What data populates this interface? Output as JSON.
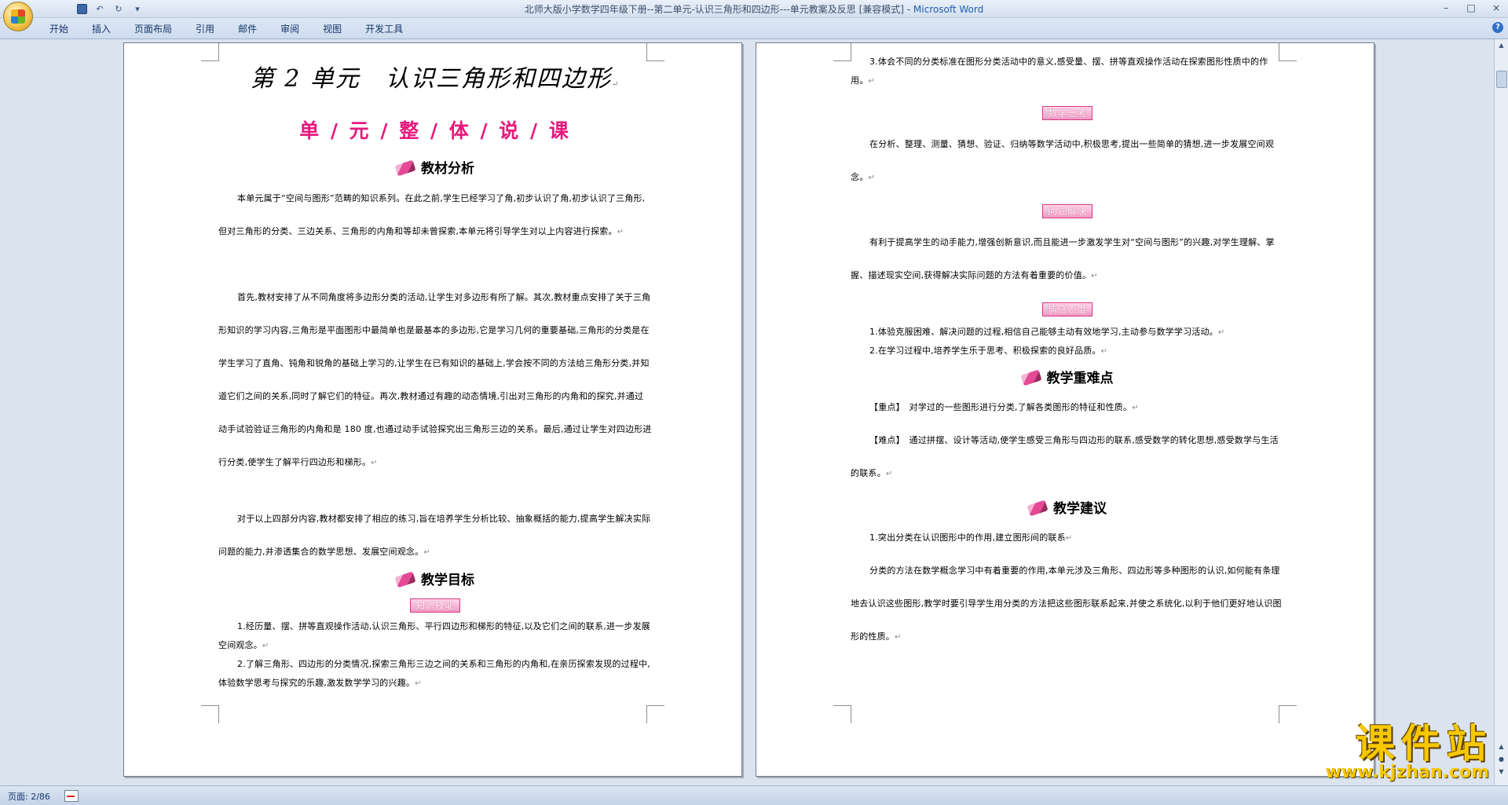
{
  "window": {
    "title": "北师大版小学数学四年级下册--第二单元-认识三角形和四边形---单元教案及反思 [兼容模式]",
    "title_separator": " - ",
    "app_name": "Microsoft Word",
    "controls": {
      "minimize": "–",
      "maximize": "□",
      "close": "×"
    }
  },
  "qat": {
    "save_icon": "save-icon",
    "undo": "↶",
    "redo": "↻",
    "customize": "▾"
  },
  "ribbon": {
    "tabs": [
      "开始",
      "插入",
      "页面布局",
      "引用",
      "邮件",
      "审阅",
      "视图",
      "开发工具"
    ],
    "help": "?"
  },
  "page1": {
    "title": "第 2 单元　认识三角形和四边形",
    "subtitle": "单 / 元 / 整 / 体 / 说 / 课",
    "sections": {
      "analysis": "教材分析",
      "goals": "教学目标",
      "knowledge_tag": "知识技能"
    },
    "para1": "本单元属于“空间与图形”范畴的知识系列。在此之前,学生已经学习了角,初步认识了角,初步认识了三角形,但对三角形的分类、三边关系、三角形的内角和等却未曾探索,本单元将引导学生对以上内容进行探索。",
    "para2": "首先,教材安排了从不同角度将多边形分类的活动,让学生对多边形有所了解。其次,教材重点安排了关于三角形知识的学习内容,三角形是平面图形中最简单也是最基本的多边形,它是学习几何的重要基础,三角形的分类是在学生学习了直角、钝角和锐角的基础上学习的,让学生在已有知识的基础上,学会按不同的方法给三角形分类,并知道它们之间的关系,同时了解它们的特征。再次,教材通过有趣的动态情境,引出对三角形的内角和的探究,并通过动手试验验证三角形的内角和是 180 度,也通过动手试验探究出三角形三边的关系。最后,通过让学生对四边形进行分类,使学生了解平行四边形和梯形。",
    "para3": "对于以上四部分内容,教材都安排了相应的练习,旨在培养学生分析比较、抽象概括的能力,提高学生解决实际问题的能力,并渗透集合的数学思想、发展空间观念。",
    "goal1": "1.经历量、摆、拼等直观操作活动,认识三角形、平行四边形和梯形的特征,以及它们之间的联系,进一步发展空间观念。",
    "goal2": "2.了解三角形、四边形的分类情况,探索三角形三边之间的关系和三角形的内角和,在亲历探索发现的过程中,体验数学思考与探究的乐趣,激发数学学习的兴趣。"
  },
  "page2": {
    "goal3": "3.体会不同的分类标准在图形分类活动中的意义,感受量、摆、拼等直观操作活动在探索图形性质中的作用。",
    "tags": {
      "thinking": "数学思考",
      "problem": "问题解决",
      "attitude": "情感态度"
    },
    "thinking_text": "在分析、整理、测量、猜想、验证、归纳等数学活动中,积极思考,提出一些简单的猜想,进一步发展空间观念。",
    "problem_text": "有利于提高学生的动手能力,增强创新意识,而且能进一步激发学生对“空间与图形”的兴趣,对学生理解、掌握、描述现实空间,获得解决实际问题的方法有着重要的价值。",
    "attitude1": "1.体验克服困难、解决问题的过程,相信自己能够主动有效地学习,主动参与数学学习活动。",
    "attitude2": "2.在学习过程中,培养学生乐于思考、积极探索的良好品质。",
    "sections": {
      "keypoints": "教学重难点",
      "suggestions": "教学建议"
    },
    "key_label": "【重点】",
    "key_text": "对学过的一些图形进行分类,了解各类图形的特征和性质。",
    "diff_label": "【难点】",
    "diff_text": "通过拼摆、设计等活动,使学生感受三角形与四边形的联系,感受数学的转化思想,感受数学与生活的联系。",
    "sugg1": "1.突出分类在认识图形中的作用,建立图形间的联系",
    "sugg_text": "分类的方法在数学概念学习中有着重要的作用,本单元涉及三角形、四边形等多种图形的认识,如何能有条理地去认识这些图形,教学时要引导学生用分类的方法把这些图形联系起来,并使之系统化,以利于他们更好地认识图形的性质。"
  },
  "paragraph_mark": "↵",
  "status": {
    "page_count": "页面: 2/86"
  },
  "watermark": {
    "title": "课件站",
    "url": "www.kjzhan.com"
  },
  "colors": {
    "accent_pink": "#e6197d",
    "watermark_yellow": "#f6c800"
  }
}
